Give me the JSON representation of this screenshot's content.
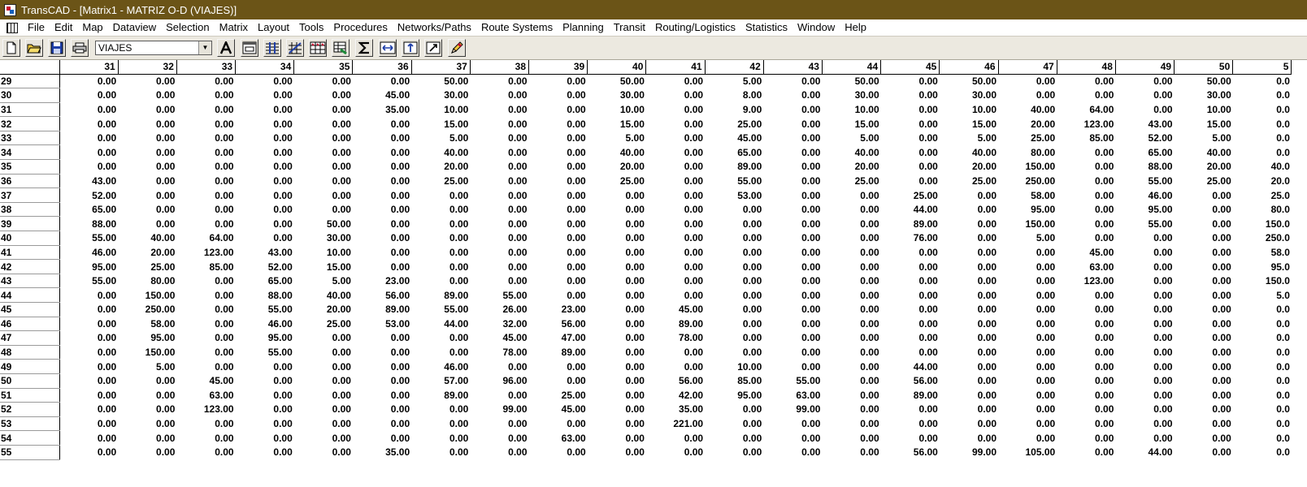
{
  "window": {
    "title": "TransCAD - [Matrix1 - MATRIZ O-D (VIAJES)]"
  },
  "menu": [
    "File",
    "Edit",
    "Map",
    "Dataview",
    "Selection",
    "Matrix",
    "Layout",
    "Tools",
    "Procedures",
    "Networks/Paths",
    "Route Systems",
    "Planning",
    "Transit",
    "Routing/Logistics",
    "Statistics",
    "Window",
    "Help"
  ],
  "toolbar": {
    "core_selector": {
      "value": "VIAJES"
    },
    "icons": [
      "new-file-icon",
      "open-folder-icon",
      "save-disk-icon",
      "print-icon",
      "text-style-icon",
      "matrix-properties-icon",
      "matrix-indices-icon",
      "matrix-operations-icon",
      "matrix-fill-icon",
      "matrix-contents-icon",
      "sum-icon",
      "expand-columns-icon",
      "sort-icon",
      "link-icon",
      "pencil-eraser-icon"
    ]
  },
  "matrix": {
    "columns": [
      "31",
      "32",
      "33",
      "34",
      "35",
      "36",
      "37",
      "38",
      "39",
      "40",
      "41",
      "42",
      "43",
      "44",
      "45",
      "46",
      "47",
      "48",
      "49",
      "50",
      "5"
    ],
    "rows": [
      {
        "id": "29",
        "values": [
          "0.00",
          "0.00",
          "0.00",
          "0.00",
          "0.00",
          "0.00",
          "50.00",
          "0.00",
          "0.00",
          "50.00",
          "0.00",
          "5.00",
          "0.00",
          "50.00",
          "0.00",
          "50.00",
          "0.00",
          "0.00",
          "0.00",
          "50.00",
          "0.0"
        ]
      },
      {
        "id": "30",
        "values": [
          "0.00",
          "0.00",
          "0.00",
          "0.00",
          "0.00",
          "45.00",
          "30.00",
          "0.00",
          "0.00",
          "30.00",
          "0.00",
          "8.00",
          "0.00",
          "30.00",
          "0.00",
          "30.00",
          "0.00",
          "0.00",
          "0.00",
          "30.00",
          "0.0"
        ]
      },
      {
        "id": "31",
        "values": [
          "0.00",
          "0.00",
          "0.00",
          "0.00",
          "0.00",
          "35.00",
          "10.00",
          "0.00",
          "0.00",
          "10.00",
          "0.00",
          "9.00",
          "0.00",
          "10.00",
          "0.00",
          "10.00",
          "40.00",
          "64.00",
          "0.00",
          "10.00",
          "0.0"
        ]
      },
      {
        "id": "32",
        "values": [
          "0.00",
          "0.00",
          "0.00",
          "0.00",
          "0.00",
          "0.00",
          "15.00",
          "0.00",
          "0.00",
          "15.00",
          "0.00",
          "25.00",
          "0.00",
          "15.00",
          "0.00",
          "15.00",
          "20.00",
          "123.00",
          "43.00",
          "15.00",
          "0.0"
        ]
      },
      {
        "id": "33",
        "values": [
          "0.00",
          "0.00",
          "0.00",
          "0.00",
          "0.00",
          "0.00",
          "5.00",
          "0.00",
          "0.00",
          "5.00",
          "0.00",
          "45.00",
          "0.00",
          "5.00",
          "0.00",
          "5.00",
          "25.00",
          "85.00",
          "52.00",
          "5.00",
          "0.0"
        ]
      },
      {
        "id": "34",
        "values": [
          "0.00",
          "0.00",
          "0.00",
          "0.00",
          "0.00",
          "0.00",
          "40.00",
          "0.00",
          "0.00",
          "40.00",
          "0.00",
          "65.00",
          "0.00",
          "40.00",
          "0.00",
          "40.00",
          "80.00",
          "0.00",
          "65.00",
          "40.00",
          "0.0"
        ]
      },
      {
        "id": "35",
        "values": [
          "0.00",
          "0.00",
          "0.00",
          "0.00",
          "0.00",
          "0.00",
          "20.00",
          "0.00",
          "0.00",
          "20.00",
          "0.00",
          "89.00",
          "0.00",
          "20.00",
          "0.00",
          "20.00",
          "150.00",
          "0.00",
          "88.00",
          "20.00",
          "40.0"
        ]
      },
      {
        "id": "36",
        "values": [
          "43.00",
          "0.00",
          "0.00",
          "0.00",
          "0.00",
          "0.00",
          "25.00",
          "0.00",
          "0.00",
          "25.00",
          "0.00",
          "55.00",
          "0.00",
          "25.00",
          "0.00",
          "25.00",
          "250.00",
          "0.00",
          "55.00",
          "25.00",
          "20.0"
        ]
      },
      {
        "id": "37",
        "values": [
          "52.00",
          "0.00",
          "0.00",
          "0.00",
          "0.00",
          "0.00",
          "0.00",
          "0.00",
          "0.00",
          "0.00",
          "0.00",
          "53.00",
          "0.00",
          "0.00",
          "25.00",
          "0.00",
          "58.00",
          "0.00",
          "46.00",
          "0.00",
          "25.0"
        ]
      },
      {
        "id": "38",
        "values": [
          "65.00",
          "0.00",
          "0.00",
          "0.00",
          "0.00",
          "0.00",
          "0.00",
          "0.00",
          "0.00",
          "0.00",
          "0.00",
          "0.00",
          "0.00",
          "0.00",
          "44.00",
          "0.00",
          "95.00",
          "0.00",
          "95.00",
          "0.00",
          "80.0"
        ]
      },
      {
        "id": "39",
        "values": [
          "88.00",
          "0.00",
          "0.00",
          "0.00",
          "50.00",
          "0.00",
          "0.00",
          "0.00",
          "0.00",
          "0.00",
          "0.00",
          "0.00",
          "0.00",
          "0.00",
          "89.00",
          "0.00",
          "150.00",
          "0.00",
          "55.00",
          "0.00",
          "150.0"
        ]
      },
      {
        "id": "40",
        "values": [
          "55.00",
          "40.00",
          "64.00",
          "0.00",
          "30.00",
          "0.00",
          "0.00",
          "0.00",
          "0.00",
          "0.00",
          "0.00",
          "0.00",
          "0.00",
          "0.00",
          "76.00",
          "0.00",
          "5.00",
          "0.00",
          "0.00",
          "0.00",
          "250.0"
        ]
      },
      {
        "id": "41",
        "values": [
          "46.00",
          "20.00",
          "123.00",
          "43.00",
          "10.00",
          "0.00",
          "0.00",
          "0.00",
          "0.00",
          "0.00",
          "0.00",
          "0.00",
          "0.00",
          "0.00",
          "0.00",
          "0.00",
          "0.00",
          "45.00",
          "0.00",
          "0.00",
          "58.0"
        ]
      },
      {
        "id": "42",
        "values": [
          "95.00",
          "25.00",
          "85.00",
          "52.00",
          "15.00",
          "0.00",
          "0.00",
          "0.00",
          "0.00",
          "0.00",
          "0.00",
          "0.00",
          "0.00",
          "0.00",
          "0.00",
          "0.00",
          "0.00",
          "63.00",
          "0.00",
          "0.00",
          "95.0"
        ]
      },
      {
        "id": "43",
        "values": [
          "55.00",
          "80.00",
          "0.00",
          "65.00",
          "5.00",
          "23.00",
          "0.00",
          "0.00",
          "0.00",
          "0.00",
          "0.00",
          "0.00",
          "0.00",
          "0.00",
          "0.00",
          "0.00",
          "0.00",
          "123.00",
          "0.00",
          "0.00",
          "150.0"
        ]
      },
      {
        "id": "44",
        "values": [
          "0.00",
          "150.00",
          "0.00",
          "88.00",
          "40.00",
          "56.00",
          "89.00",
          "55.00",
          "0.00",
          "0.00",
          "0.00",
          "0.00",
          "0.00",
          "0.00",
          "0.00",
          "0.00",
          "0.00",
          "0.00",
          "0.00",
          "0.00",
          "5.0"
        ]
      },
      {
        "id": "45",
        "values": [
          "0.00",
          "250.00",
          "0.00",
          "55.00",
          "20.00",
          "89.00",
          "55.00",
          "26.00",
          "23.00",
          "0.00",
          "45.00",
          "0.00",
          "0.00",
          "0.00",
          "0.00",
          "0.00",
          "0.00",
          "0.00",
          "0.00",
          "0.00",
          "0.0"
        ]
      },
      {
        "id": "46",
        "values": [
          "0.00",
          "58.00",
          "0.00",
          "46.00",
          "25.00",
          "53.00",
          "44.00",
          "32.00",
          "56.00",
          "0.00",
          "89.00",
          "0.00",
          "0.00",
          "0.00",
          "0.00",
          "0.00",
          "0.00",
          "0.00",
          "0.00",
          "0.00",
          "0.0"
        ]
      },
      {
        "id": "47",
        "values": [
          "0.00",
          "95.00",
          "0.00",
          "95.00",
          "0.00",
          "0.00",
          "0.00",
          "45.00",
          "47.00",
          "0.00",
          "78.00",
          "0.00",
          "0.00",
          "0.00",
          "0.00",
          "0.00",
          "0.00",
          "0.00",
          "0.00",
          "0.00",
          "0.0"
        ]
      },
      {
        "id": "48",
        "values": [
          "0.00",
          "150.00",
          "0.00",
          "55.00",
          "0.00",
          "0.00",
          "0.00",
          "78.00",
          "89.00",
          "0.00",
          "0.00",
          "0.00",
          "0.00",
          "0.00",
          "0.00",
          "0.00",
          "0.00",
          "0.00",
          "0.00",
          "0.00",
          "0.0"
        ]
      },
      {
        "id": "49",
        "values": [
          "0.00",
          "5.00",
          "0.00",
          "0.00",
          "0.00",
          "0.00",
          "46.00",
          "0.00",
          "0.00",
          "0.00",
          "0.00",
          "10.00",
          "0.00",
          "0.00",
          "44.00",
          "0.00",
          "0.00",
          "0.00",
          "0.00",
          "0.00",
          "0.0"
        ]
      },
      {
        "id": "50",
        "values": [
          "0.00",
          "0.00",
          "45.00",
          "0.00",
          "0.00",
          "0.00",
          "57.00",
          "96.00",
          "0.00",
          "0.00",
          "56.00",
          "85.00",
          "55.00",
          "0.00",
          "56.00",
          "0.00",
          "0.00",
          "0.00",
          "0.00",
          "0.00",
          "0.0"
        ]
      },
      {
        "id": "51",
        "values": [
          "0.00",
          "0.00",
          "63.00",
          "0.00",
          "0.00",
          "0.00",
          "89.00",
          "0.00",
          "25.00",
          "0.00",
          "42.00",
          "95.00",
          "63.00",
          "0.00",
          "89.00",
          "0.00",
          "0.00",
          "0.00",
          "0.00",
          "0.00",
          "0.0"
        ]
      },
      {
        "id": "52",
        "values": [
          "0.00",
          "0.00",
          "123.00",
          "0.00",
          "0.00",
          "0.00",
          "0.00",
          "99.00",
          "45.00",
          "0.00",
          "35.00",
          "0.00",
          "99.00",
          "0.00",
          "0.00",
          "0.00",
          "0.00",
          "0.00",
          "0.00",
          "0.00",
          "0.0"
        ]
      },
      {
        "id": "53",
        "values": [
          "0.00",
          "0.00",
          "0.00",
          "0.00",
          "0.00",
          "0.00",
          "0.00",
          "0.00",
          "0.00",
          "0.00",
          "221.00",
          "0.00",
          "0.00",
          "0.00",
          "0.00",
          "0.00",
          "0.00",
          "0.00",
          "0.00",
          "0.00",
          "0.0"
        ]
      },
      {
        "id": "54",
        "values": [
          "0.00",
          "0.00",
          "0.00",
          "0.00",
          "0.00",
          "0.00",
          "0.00",
          "0.00",
          "63.00",
          "0.00",
          "0.00",
          "0.00",
          "0.00",
          "0.00",
          "0.00",
          "0.00",
          "0.00",
          "0.00",
          "0.00",
          "0.00",
          "0.0"
        ]
      },
      {
        "id": "55",
        "values": [
          "0.00",
          "0.00",
          "0.00",
          "0.00",
          "0.00",
          "35.00",
          "0.00",
          "0.00",
          "0.00",
          "0.00",
          "0.00",
          "0.00",
          "0.00",
          "0.00",
          "56.00",
          "99.00",
          "105.00",
          "0.00",
          "44.00",
          "0.00",
          "0.0"
        ]
      }
    ]
  }
}
